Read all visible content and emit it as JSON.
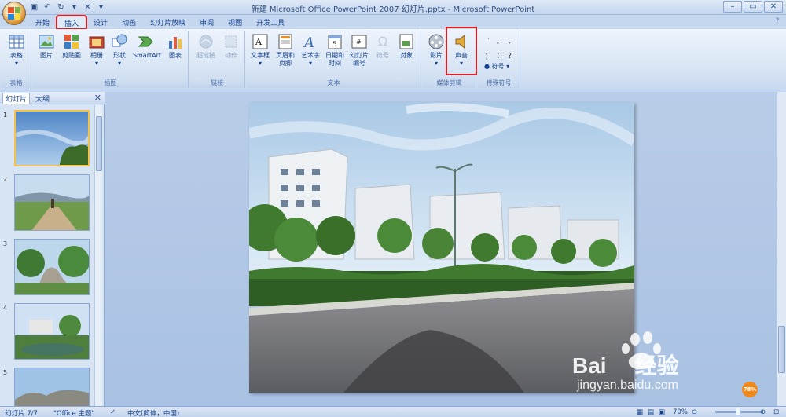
{
  "window": {
    "title": "新建 Microsoft Office PowerPoint 2007 幻灯片.pptx - Microsoft PowerPoint"
  },
  "tabs": [
    {
      "label": "开始",
      "active": false
    },
    {
      "label": "插入",
      "active": true
    },
    {
      "label": "设计",
      "active": false
    },
    {
      "label": "动画",
      "active": false
    },
    {
      "label": "幻灯片放映",
      "active": false
    },
    {
      "label": "审阅",
      "active": false
    },
    {
      "label": "视图",
      "active": false
    },
    {
      "label": "开发工具",
      "active": false
    }
  ],
  "ribbon": {
    "groups": {
      "table": "表格",
      "illustrations": "插图",
      "links": "链接",
      "text": "文本",
      "media": "媒体剪辑",
      "special": "特殊符号"
    },
    "buttons": {
      "table": "表格",
      "picture": "图片",
      "clipart": "剪贴画",
      "album": "相册",
      "shapes": "形状",
      "smartart": "SmartArt",
      "chart": "图表",
      "hyperlink": "超链接",
      "action": "动作",
      "textbox": "文本框",
      "header_line1": "页眉和",
      "header_line2": "页脚",
      "wordart": "艺术字",
      "datetime_line1": "日期和",
      "datetime_line2": "时间",
      "slidenum_line1": "幻灯片",
      "slidenum_line2": "编号",
      "symbol": "符号",
      "object": "对象",
      "movie": "影片",
      "sound": "声音",
      "special_symbol": "符号"
    },
    "special_chars": [
      "·",
      "。",
      "、",
      "；",
      "：",
      "？"
    ]
  },
  "left_pane": {
    "tabs": [
      "幻灯片",
      "大纲"
    ],
    "slide_numbers": [
      "1",
      "2",
      "3",
      "4",
      "5"
    ]
  },
  "status": {
    "slide": "幻灯片 7/7",
    "theme": "\"Office 主题\"",
    "language": "中文(简体，中国)",
    "zoom": "70%"
  },
  "watermark": {
    "brand": "Bai",
    "brand_cn": "经验",
    "url": "jingyan.baidu.com",
    "badge": "78%"
  },
  "colors": {
    "highlight": "#e21b1b",
    "ribbon_text": "#15428b"
  }
}
